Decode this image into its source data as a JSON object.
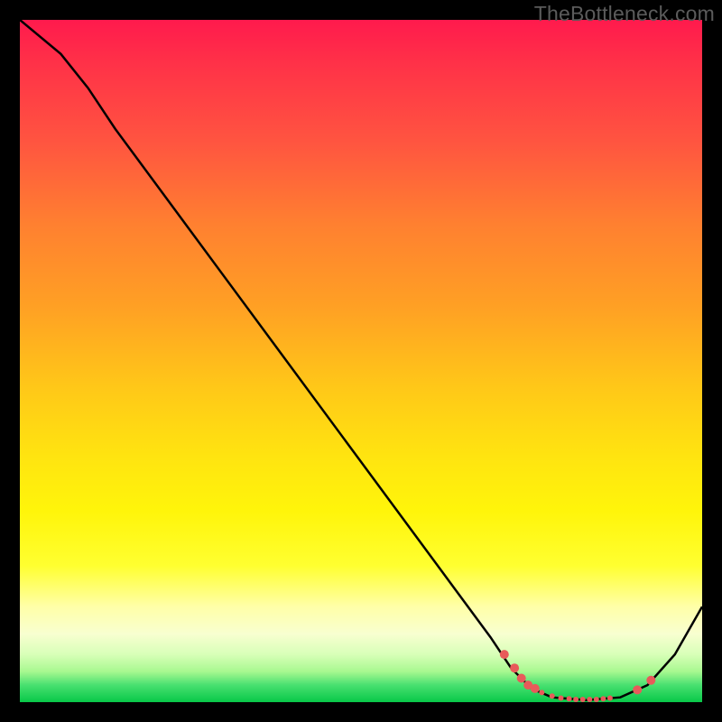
{
  "watermark": "TheBottleneck.com",
  "chart_data": {
    "type": "line",
    "title": "",
    "xlabel": "",
    "ylabel": "",
    "xlim": [
      0,
      100
    ],
    "ylim": [
      0,
      100
    ],
    "curve": [
      {
        "x": 0,
        "y": 100
      },
      {
        "x": 6,
        "y": 95
      },
      {
        "x": 10,
        "y": 90
      },
      {
        "x": 14,
        "y": 84
      },
      {
        "x": 69,
        "y": 9.5
      },
      {
        "x": 72,
        "y": 5
      },
      {
        "x": 75,
        "y": 2
      },
      {
        "x": 78,
        "y": 0.7
      },
      {
        "x": 83,
        "y": 0.3
      },
      {
        "x": 88,
        "y": 0.7
      },
      {
        "x": 92,
        "y": 2.5
      },
      {
        "x": 96,
        "y": 7
      },
      {
        "x": 100,
        "y": 14
      }
    ],
    "dots": [
      {
        "x": 71.0,
        "y": 7.0,
        "r": 5
      },
      {
        "x": 72.5,
        "y": 5.0,
        "r": 5
      },
      {
        "x": 73.5,
        "y": 3.5,
        "r": 5
      },
      {
        "x": 74.5,
        "y": 2.5,
        "r": 5
      },
      {
        "x": 75.5,
        "y": 2.0,
        "r": 5
      },
      {
        "x": 76.5,
        "y": 1.4,
        "r": 3
      },
      {
        "x": 78.0,
        "y": 0.9,
        "r": 3
      },
      {
        "x": 79.3,
        "y": 0.6,
        "r": 3
      },
      {
        "x": 80.5,
        "y": 0.5,
        "r": 3
      },
      {
        "x": 81.5,
        "y": 0.4,
        "r": 3
      },
      {
        "x": 82.5,
        "y": 0.4,
        "r": 3
      },
      {
        "x": 83.5,
        "y": 0.4,
        "r": 3
      },
      {
        "x": 84.5,
        "y": 0.4,
        "r": 3
      },
      {
        "x": 85.5,
        "y": 0.5,
        "r": 3
      },
      {
        "x": 86.5,
        "y": 0.6,
        "r": 3
      },
      {
        "x": 90.5,
        "y": 1.8,
        "r": 5
      },
      {
        "x": 92.5,
        "y": 3.2,
        "r": 5
      }
    ],
    "gradient_bg": true
  }
}
